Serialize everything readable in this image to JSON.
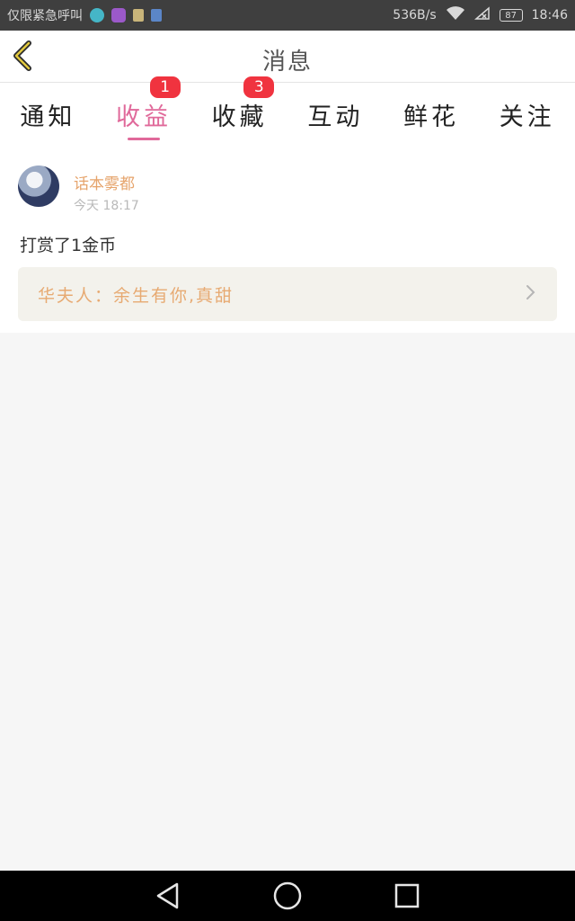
{
  "status_bar": {
    "carrier_text": "仅限紧急呼叫",
    "speed": "536B/s",
    "battery": "87",
    "time": "18:46"
  },
  "header": {
    "title": "消息",
    "back_icon": "chevron-left-icon"
  },
  "tabs": [
    {
      "label": "通知",
      "badge": ""
    },
    {
      "label": "收益",
      "badge": "1",
      "active": true
    },
    {
      "label": "收藏",
      "badge": "3"
    },
    {
      "label": "互动",
      "badge": ""
    },
    {
      "label": "鲜花",
      "badge": ""
    },
    {
      "label": "关注",
      "badge": ""
    }
  ],
  "message": {
    "username": "话本雾都",
    "time": "今天 18:17",
    "text": "打赏了1金币",
    "quote": "华夫人：余生有你,真甜"
  },
  "colors": {
    "accent": "#e0699a",
    "badge": "#f0333f",
    "username": "#e6a46c",
    "quote_bg": "#f3f2ec"
  }
}
